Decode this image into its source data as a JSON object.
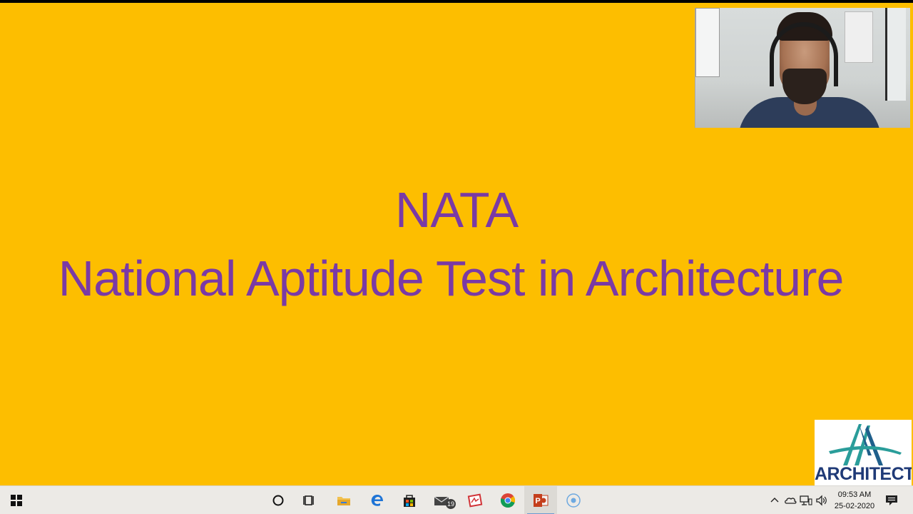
{
  "slide": {
    "title": "NATA",
    "subtitle": "National Aptitude Test in Architecture",
    "background_color": "#FDBE00",
    "text_color": "#7A3AA5"
  },
  "logo": {
    "text": "ARCHITECTS"
  },
  "taskbar": {
    "icons": [
      {
        "name": "start-icon"
      },
      {
        "name": "cortana-search-icon"
      },
      {
        "name": "task-view-icon"
      },
      {
        "name": "file-explorer-icon"
      },
      {
        "name": "edge-icon"
      },
      {
        "name": "store-icon"
      },
      {
        "name": "mail-icon"
      },
      {
        "name": "pdf-reader-icon"
      },
      {
        "name": "chrome-icon"
      },
      {
        "name": "powerpoint-icon"
      },
      {
        "name": "recording-icon"
      }
    ],
    "mail_badge": "19",
    "tray": {
      "time": "09:53 AM",
      "date": "25-02-2020"
    }
  }
}
